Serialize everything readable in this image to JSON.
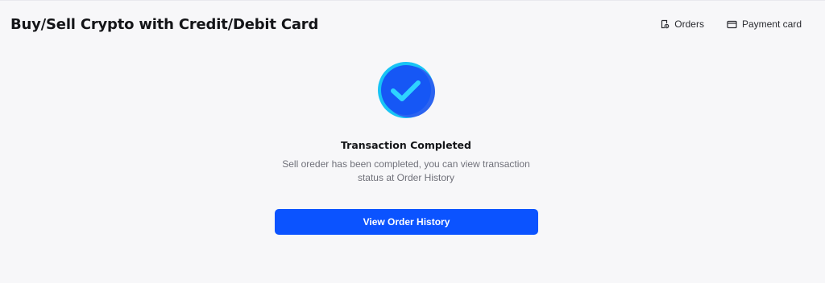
{
  "header": {
    "title": "Buy/Sell Crypto with Credit/Debit Card",
    "links": [
      {
        "label": "Orders",
        "icon": "orders-icon"
      },
      {
        "label": "Payment card",
        "icon": "credit-card-icon"
      }
    ]
  },
  "status": {
    "icon": "check-circle-icon",
    "title": "Transaction Completed",
    "description": "Sell oreder has been completed, you can view transaction status at Order History"
  },
  "actions": {
    "primary_label": "View Order History"
  },
  "colors": {
    "accent": "#0b53ff",
    "icon_cyan": "#18c4f5",
    "icon_blue": "#2b63f0",
    "background": "#f7f7f9"
  }
}
